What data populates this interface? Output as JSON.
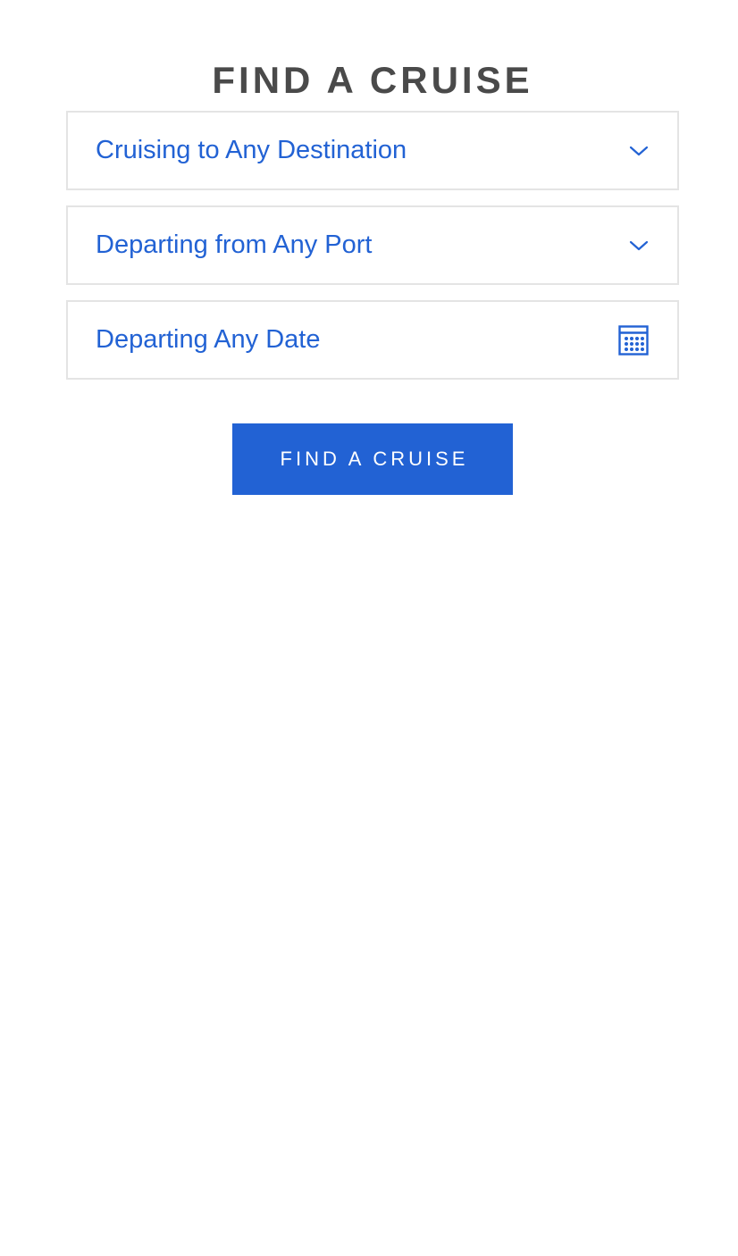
{
  "title": "FIND A CRUISE",
  "fields": [
    {
      "label": "Cruising to Any Destination",
      "icon": "chevron-down-icon"
    },
    {
      "label": "Departing from Any Port",
      "icon": "chevron-down-icon"
    },
    {
      "label": "Departing Any Date",
      "icon": "calendar-icon"
    }
  ],
  "search_button": {
    "label": "FIND A CRUISE"
  },
  "colors": {
    "accent": "#2262d4",
    "title": "#4a4a4a",
    "border": "#e4e4e4",
    "background": "#ffffff"
  }
}
